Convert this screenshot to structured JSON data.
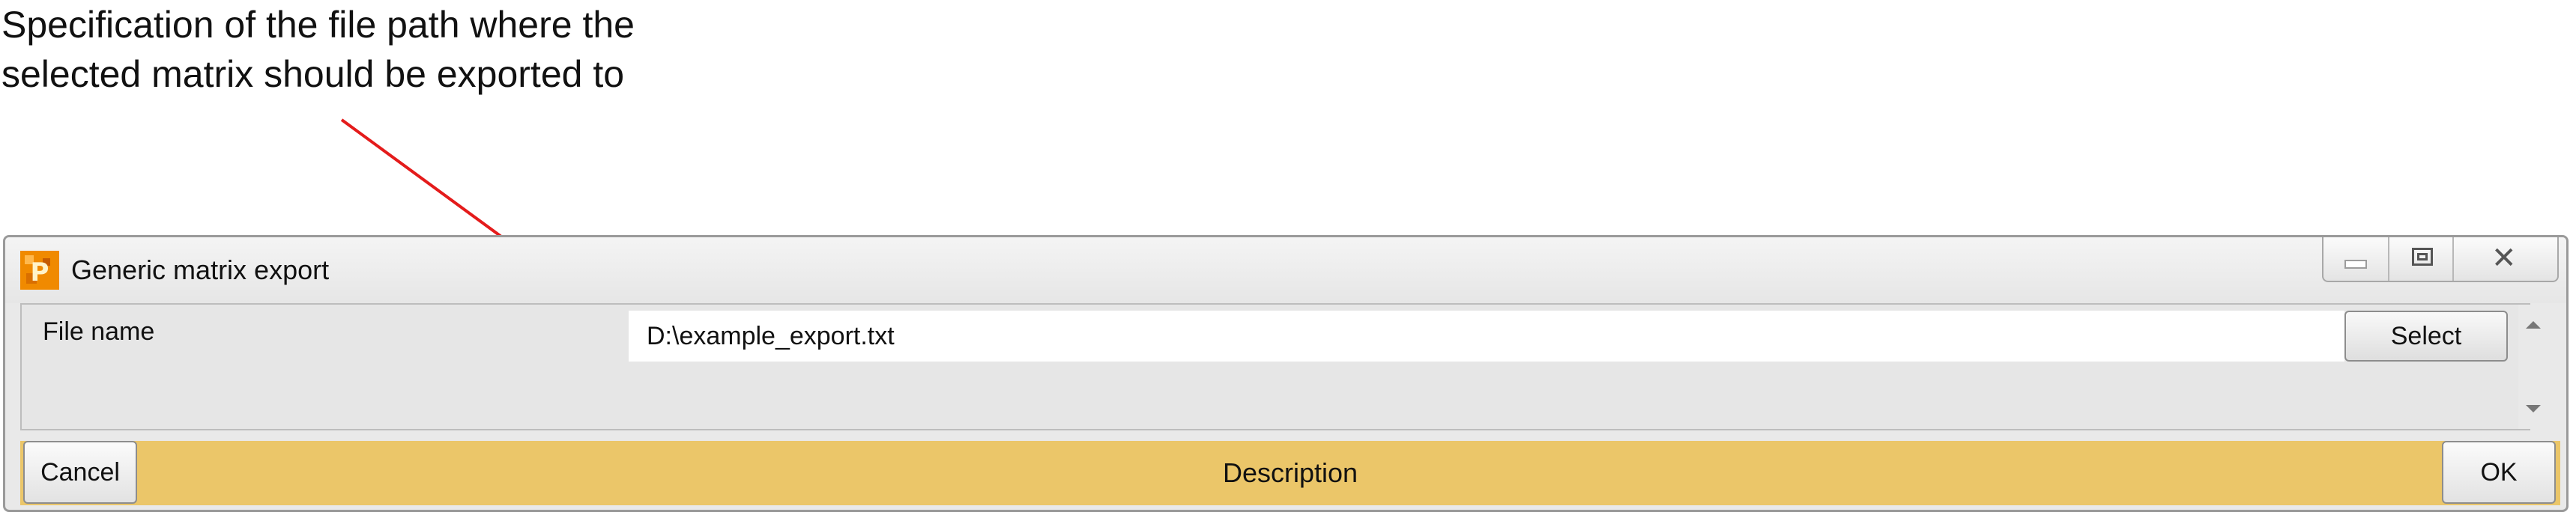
{
  "annotation": {
    "line1": "Specification of the file path where the",
    "line2": "selected matrix should be exported to"
  },
  "window": {
    "title": "Generic matrix export",
    "app_icon": "app-logo-icon",
    "controls": {
      "minimize_icon": "minimize-icon",
      "maximize_icon": "restore-icon",
      "close_icon": "close-icon",
      "close_glyph": "✕"
    }
  },
  "form": {
    "file_name_label": "File name",
    "file_name_value": "D:\\example_export.txt",
    "select_label": "Select"
  },
  "footer": {
    "cancel_label": "Cancel",
    "description": "Description",
    "ok_label": "OK"
  },
  "colors": {
    "footer_bar": "#ebc669",
    "arrow": "#e41b1b",
    "app_icon": "#f08a00"
  }
}
